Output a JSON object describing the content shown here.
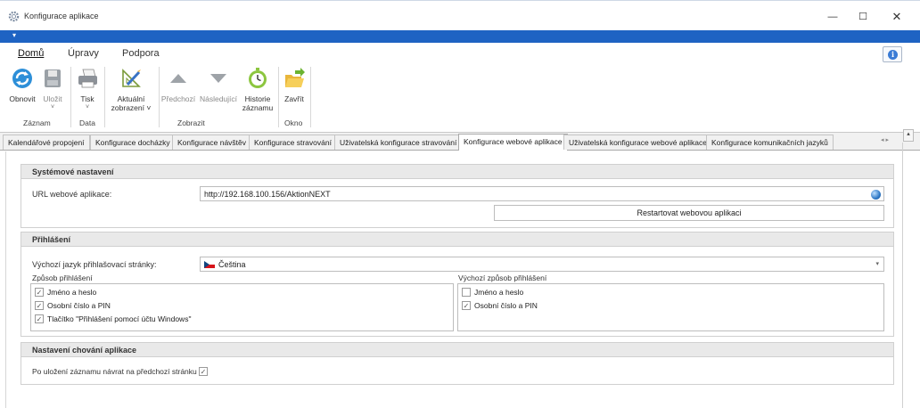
{
  "window": {
    "title": "Konfigurace aplikace",
    "min": "—",
    "max": "☐",
    "close": "✕"
  },
  "quick_access": "▾",
  "ribbon_tabs": [
    "Domů",
    "Úpravy",
    "Podpora"
  ],
  "ribbon": {
    "buttons": {
      "refresh": "Obnovit",
      "save": "Uložit",
      "print": "Tisk",
      "current_view_1": "Aktuální",
      "current_view_2": "zobrazení ˅",
      "previous": "Předchozí",
      "next": "Následující",
      "history_1": "Historie",
      "history_2": "záznamu",
      "close": "Zavřít"
    },
    "groups": [
      "Záznam",
      "Data",
      "Zobrazit",
      "Okno"
    ],
    "caret": "˅"
  },
  "doc_tabs": [
    "Kalendářové propojení",
    "Konfigurace docházky",
    "Konfigurace návštěv",
    "Konfigurace stravování",
    "Uživatelská konfigurace stravování",
    "Konfigurace webové aplikace",
    "Uživatelská konfigurace webové aplikace",
    "Konfigurace komunikačních jazyků"
  ],
  "tab_arrows": "◂ ▸",
  "scroll_up": "▴",
  "system": {
    "header": "Systémové nastavení",
    "url_label": "URL webové aplikace:",
    "url_value": "http://192.168.100.156/AktionNEXT",
    "restart_button": "Restartovat webovou aplikaci"
  },
  "login": {
    "header": "Přihlášení",
    "language_label": "Výchozí jazyk přihlašovací stránky:",
    "language_value": "Čeština",
    "dropdown_arrow": "▾",
    "methods_label": "Způsob přihlášení",
    "methods": [
      {
        "label": "Jméno a heslo",
        "checked": true
      },
      {
        "label": "Osobní číslo a PIN",
        "checked": true
      },
      {
        "label": "Tlačítko \"Přihlášení pomocí účtu Windows\"",
        "checked": true
      }
    ],
    "default_label": "Výchozí způsob přihlášení",
    "default_methods": [
      {
        "label": "Jméno a heslo",
        "checked": false
      },
      {
        "label": "Osobní číslo a PIN",
        "checked": true
      }
    ],
    "check_mark": "✓"
  },
  "behavior": {
    "header": "Nastavení chování aplikace",
    "return_label": "Po uložení záznamu návrat na předchozí stránku",
    "return_checked": true
  },
  "colors": {
    "accent": "#1e63c3",
    "section_header": "#e9e9e9"
  }
}
